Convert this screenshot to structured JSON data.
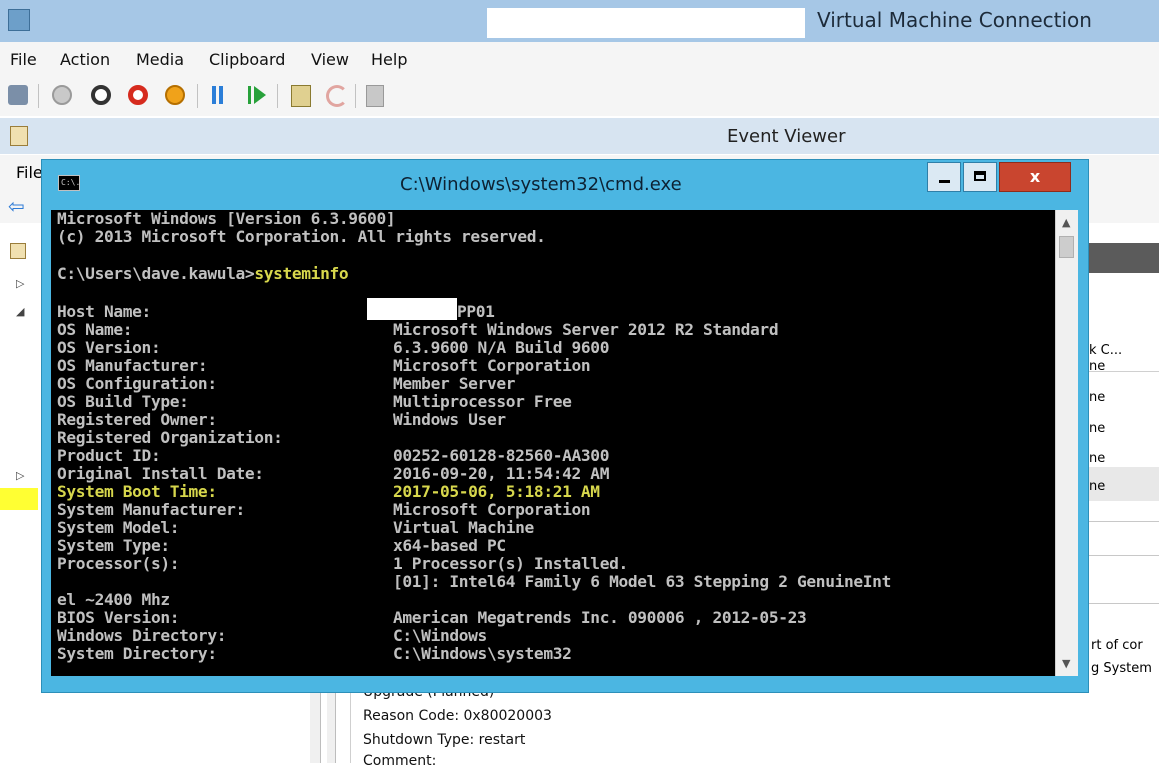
{
  "vm_window": {
    "title": "Virtual Machine Connection",
    "menu": [
      "File",
      "Action",
      "Media",
      "Clipboard",
      "View",
      "Help"
    ],
    "toolbar_icons": [
      "ctrl-alt-del-icon",
      "start-icon",
      "turn-off-icon",
      "shut-down-icon",
      "power-icon",
      "pause-icon",
      "resume-icon",
      "checkpoint-icon",
      "revert-icon",
      "enhanced-session-icon"
    ]
  },
  "event_viewer": {
    "title": "Event Viewer",
    "menu_first": "File",
    "right_pane": {
      "column_header": "k C...",
      "rows": [
        "ne",
        "ne",
        "ne",
        "ne",
        "ne"
      ],
      "desc_lines": [
        "rt of cor",
        "g System"
      ]
    },
    "details": [
      "Upgrade (Planned)",
      "Reason Code: 0x80020003",
      "Shutdown Type: restart",
      "Comment:"
    ]
  },
  "cmd": {
    "title": "C:\\Windows\\system32\\cmd.exe",
    "close_glyph": "x",
    "icon_label": "C:\\.",
    "header_lines": [
      "Microsoft Windows [Version 6.3.9600]",
      "(c) 2013 Microsoft Corporation. All rights reserved."
    ],
    "prompt": "C:\\Users\\dave.kawula>",
    "command": "systeminfo",
    "info": [
      {
        "label": "Host Name:",
        "value": "PP01"
      },
      {
        "label": "OS Name:",
        "value": "Microsoft Windows Server 2012 R2 Standard"
      },
      {
        "label": "OS Version:",
        "value": "6.3.9600 N/A Build 9600"
      },
      {
        "label": "OS Manufacturer:",
        "value": "Microsoft Corporation"
      },
      {
        "label": "OS Configuration:",
        "value": "Member Server"
      },
      {
        "label": "OS Build Type:",
        "value": "Multiprocessor Free"
      },
      {
        "label": "Registered Owner:",
        "value": "Windows User"
      },
      {
        "label": "Registered Organization:",
        "value": ""
      },
      {
        "label": "Product ID:",
        "value": "00252-60128-82560-AA300"
      },
      {
        "label": "Original Install Date:",
        "value": "2016-09-20, 11:54:42 AM"
      },
      {
        "label": "System Boot Time:",
        "value": "2017-05-06, 5:18:21 AM"
      },
      {
        "label": "System Manufacturer:",
        "value": "Microsoft Corporation"
      },
      {
        "label": "System Model:",
        "value": "Virtual Machine"
      },
      {
        "label": "System Type:",
        "value": "x64-based PC"
      },
      {
        "label": "Processor(s):",
        "value": "1 Processor(s) Installed."
      }
    ],
    "processor_detail": "[01]: Intel64 Family 6 Model 63 Stepping 2 GenuineInt",
    "processor_wrap": "el ~2400 Mhz",
    "info2": [
      {
        "label": "BIOS Version:",
        "value": "American Megatrends Inc. 090006 , 2012-05-23"
      },
      {
        "label": "Windows Directory:",
        "value": "C:\\Windows"
      },
      {
        "label": "System Directory:",
        "value": "C:\\Windows\\system32"
      }
    ]
  },
  "colors": {
    "console_text": "#c0c0c0",
    "console_highlight": "#d7d74c",
    "cmd_frame": "#4bb6e2",
    "close_button": "#c9452f"
  }
}
